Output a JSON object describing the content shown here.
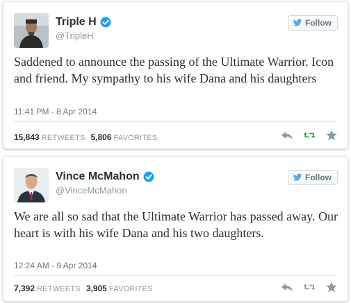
{
  "colors": {
    "verified_blue": "#1da1f2",
    "retweet_green": "#19a33a",
    "icon_gray": "#8899a6"
  },
  "tweets": [
    {
      "name": "Triple H",
      "handle": "@TripleH",
      "follow_label": "Follow",
      "text": "Saddened to announce the passing of the Ultimate Warrior. Icon and friend. My sympathy to his wife Dana and his daughters",
      "timestamp": "11:41 PM - 8 Apr 2014",
      "retweets_count": "15,843",
      "retweets_label": "RETWEETS",
      "favorites_count": "5,806",
      "favorites_label": "FAVORITES",
      "icons": [
        "reply-icon",
        "retweet-icon",
        "favorite-icon"
      ]
    },
    {
      "name": "Vince McMahon",
      "handle": "@VinceMcMahon",
      "follow_label": "Follow",
      "text": "We are all so sad that the Ultimate Warrior has passed away. Our heart is with his wife Dana and his two daughters.",
      "timestamp": "12:24 AM - 9 Apr 2014",
      "retweets_count": "7,392",
      "retweets_label": "RETWEETS",
      "favorites_count": "3,905",
      "favorites_label": "FAVORITES",
      "icons": [
        "reply-icon",
        "retweet-icon",
        "favorite-icon"
      ]
    }
  ]
}
